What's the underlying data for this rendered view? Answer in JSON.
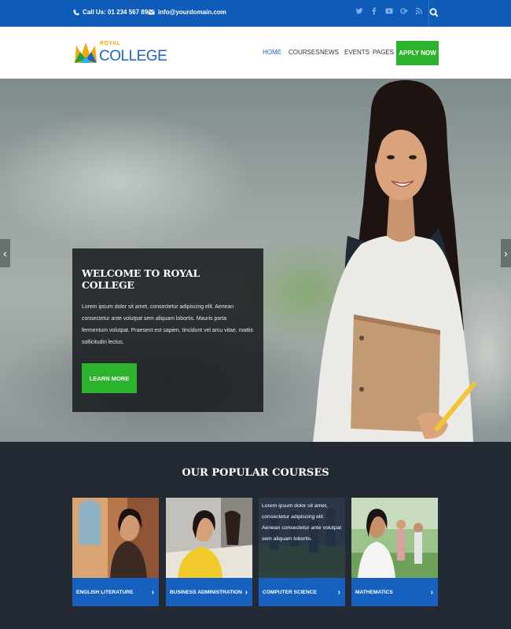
{
  "topbar": {
    "phone": "Call Us: 01 234 567 890",
    "email": "info@yourdomain.com",
    "social_icons": [
      "twitter-icon",
      "facebook-icon",
      "youtube-icon",
      "google-plus-icon",
      "rss-icon"
    ]
  },
  "header": {
    "logo_top": "ROYAL",
    "logo_main": "COLLEGE",
    "nav": [
      "HOME",
      "COURSES",
      "NEWS",
      "EVENTS",
      "PAGES"
    ],
    "active_nav": "HOME",
    "apply_label": "APPLY NOW"
  },
  "hero": {
    "title": "WELCOME TO ROYAL COLLEGE",
    "text": "Lorem ipsum dolor sit amet, consectetur adipiscing elit. Aenean consectetur ante volutpat sem aliquam lobortis. Mauris porta fermentum volutpat. Praesent est sapien, tincidunt vel arcu vitae, mattis sollicitudin lectus.",
    "button": "LEARN MORE",
    "prev_arrow": "‹",
    "next_arrow": "›"
  },
  "courses": {
    "heading": "OUR POPULAR COURSES",
    "items": [
      {
        "label": "ENGLISH LITERATURE",
        "chevron": "›"
      },
      {
        "label": "BUSINESS ADMINISTRATION",
        "chevron": "›"
      },
      {
        "label": "COMPUTER SCIENCE",
        "chevron": "›",
        "overlay": "Lorem ipsum dolor sit amet, consectetur adipiscing elit. Aenean consectetur ante volutpat sem aliquam lobortis."
      },
      {
        "label": "MATHEMATICS",
        "chevron": "›"
      }
    ]
  },
  "colors": {
    "topbar": "#0f5cb8",
    "accent_green": "#2db22d",
    "brand_blue": "#1b66c4",
    "courses_bg": "#232a33"
  }
}
